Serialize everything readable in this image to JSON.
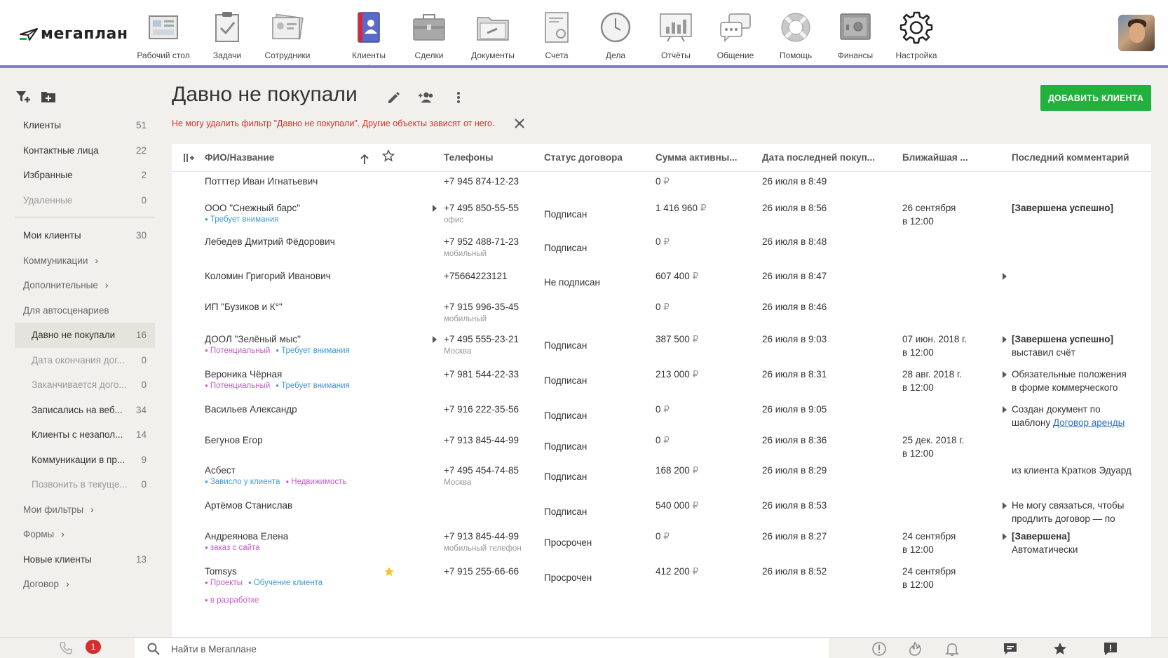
{
  "logo": {
    "text": "мегаплан"
  },
  "nav": [
    {
      "label": "Рабочий стол",
      "icon": "desktop-icon"
    },
    {
      "label": "Задачи",
      "icon": "tasks-icon"
    },
    {
      "label": "Сотрудники",
      "icon": "employees-icon"
    },
    {
      "label": "Клиенты",
      "icon": "clients-icon",
      "active": true
    },
    {
      "label": "Сделки",
      "icon": "deals-icon"
    },
    {
      "label": "Документы",
      "icon": "documents-icon"
    },
    {
      "label": "Счета",
      "icon": "invoices-icon"
    },
    {
      "label": "Дела",
      "icon": "affairs-icon"
    },
    {
      "label": "Отчёты",
      "icon": "reports-icon"
    },
    {
      "label": "Общение",
      "icon": "chat-icon"
    },
    {
      "label": "Помощь",
      "icon": "help-icon"
    },
    {
      "label": "Финансы",
      "icon": "finance-icon"
    },
    {
      "label": "Настройка",
      "icon": "settings-icon"
    }
  ],
  "sidebar": {
    "items": [
      {
        "label": "Клиенты",
        "count": "51"
      },
      {
        "label": "Контактные лица",
        "count": "22"
      },
      {
        "label": "Избранные",
        "count": "2"
      },
      {
        "label": "Удаленные",
        "count": "0"
      },
      {
        "label": "Мои клиенты",
        "count": "30"
      },
      {
        "label": "Коммуникации",
        "count": ""
      },
      {
        "label": "Дополнительные",
        "count": ""
      },
      {
        "label": "Для автосценариев",
        "count": ""
      },
      {
        "label": "Давно не покупали",
        "count": "16"
      },
      {
        "label": "Дата окончания дог...",
        "count": "0"
      },
      {
        "label": "Заканчивается дого...",
        "count": "0"
      },
      {
        "label": "Записались на веб...",
        "count": "34"
      },
      {
        "label": "Клиенты с незапол...",
        "count": "14"
      },
      {
        "label": "Коммуникации в пр...",
        "count": "9"
      },
      {
        "label": "Позвонить в текуще...",
        "count": "0"
      },
      {
        "label": "Мои фильтры",
        "count": ""
      },
      {
        "label": "Формы",
        "count": ""
      },
      {
        "label": "Новые клиенты",
        "count": "13"
      },
      {
        "label": "Договор",
        "count": ""
      }
    ]
  },
  "page": {
    "title": "Давно не покупали",
    "error": "Не могу удалить фильтр \"Давно не покупали\". Другие объекты зависят от него.",
    "add_button": "ДОБАВИТЬ КЛИЕНТА"
  },
  "table": {
    "headers": {
      "name": "ФИО/Название",
      "phones": "Телефоны",
      "status": "Статус договора",
      "sum": "Сумма активны...",
      "last_purchase": "Дата последней покуп...",
      "next": "Ближайшая ...",
      "comment": "Последний комментарий"
    },
    "rows": [
      {
        "name": "Потттер Иван Игнатьевич",
        "phone": "+7 945 874-12-23",
        "phone_sub": "",
        "status": "",
        "sum": "0",
        "date": "26 июля в 8:49",
        "next1": "",
        "next2": "",
        "comment1": "",
        "comment2": ""
      },
      {
        "name": "ООО \"Снежный барс\"",
        "phone": "+7 495 850-55-55",
        "phone_sub": "офис",
        "status": "Подписан",
        "sum": "1 416 960",
        "date": "26 июля в 8:56",
        "next1": "26 сентября",
        "next2": "в 12:00",
        "comment1": "[Завершена успешно]",
        "comment2": ""
      },
      {
        "name": "Лебедев Дмитрий Фёдорович",
        "phone": "+7 952 488-71-23",
        "phone_sub": "мобильный",
        "status": "Подписан",
        "sum": "0",
        "date": "26 июля в 8:48",
        "next1": "",
        "next2": "",
        "comment1": "",
        "comment2": ""
      },
      {
        "name": "Коломин Григорий Иванович",
        "phone": "+75664223121",
        "phone_sub": "",
        "status": "Не подписан",
        "sum": "607 400",
        "date": "26 июля в 8:47",
        "next1": "",
        "next2": "",
        "comment1": "",
        "comment2": ""
      },
      {
        "name": "ИП \"Бузиков и К°\"",
        "phone": "+7 915 996-35-45",
        "phone_sub": "мобильный",
        "status": "",
        "sum": "0",
        "date": "26 июля в 8:46",
        "next1": "",
        "next2": "",
        "comment1": "",
        "comment2": ""
      },
      {
        "name": "ДООЛ \"Зелёный мыс\"",
        "phone": "+7 495 555-23-21",
        "phone_sub": "Москва",
        "status": "Подписан",
        "sum": "387 500",
        "date": "26 июля в 9:03",
        "next1": "07 июн. 2018 г.",
        "next2": "в 12:00",
        "comment1": "[Завершена успешно]",
        "comment2": "выставил счёт"
      },
      {
        "name": "Вероника Чёрная",
        "phone": "+7 981 544-22-33",
        "phone_sub": "",
        "status": "Подписан",
        "sum": "213 000",
        "date": "26 июля в 8:31",
        "next1": "28 авг. 2018 г.",
        "next2": "в 12:00",
        "comment1": "Обязательные положения",
        "comment2": "в форме коммерческого"
      },
      {
        "name": "Васильев Александр",
        "phone": "+7 916 222-35-56",
        "phone_sub": "",
        "status": "Подписан",
        "sum": "0",
        "date": "26 июля в 9:05",
        "next1": "",
        "next2": "",
        "comment1": "Создан документ по",
        "comment2": "шаблону",
        "comment_link": "Договор аренды"
      },
      {
        "name": "Бегунов Егор",
        "phone": "+7 913 845-44-99",
        "phone_sub": "",
        "status": "Подписан",
        "sum": "0",
        "date": "26 июля в 8:36",
        "next1": "25 дек. 2018 г.",
        "next2": "в 12:00",
        "comment1": "",
        "comment2": ""
      },
      {
        "name": "Асбест",
        "phone": "+7 495 454-74-85",
        "phone_sub": "Москва",
        "status": "Подписан",
        "sum": "168 200",
        "date": "26 июля в 8:29",
        "next1": "",
        "next2": "",
        "comment1": "из клиента Кратков Эдуард",
        "comment2": ""
      },
      {
        "name": "Артёмов Станислав",
        "phone": "",
        "phone_sub": "",
        "status": "Подписан",
        "sum": "540 000",
        "date": "26 июля в 8:53",
        "next1": "",
        "next2": "",
        "comment1": "Не могу связаться, чтобы",
        "comment2": "продлить договор — по"
      },
      {
        "name": "Андреянова Елена",
        "phone": "+7 913 845-44-99",
        "phone_sub": "мобильный телефон",
        "status": "Просрочен",
        "sum": "0",
        "date": "26 июля в 8:27",
        "next1": "24 сентября",
        "next2": "в 12:00",
        "comment1": "[Завершена]",
        "comment2": "Автоматически"
      },
      {
        "name": "Tomsys",
        "phone": "+7 915 255-66-66",
        "phone_sub": "",
        "status": "Просрочен",
        "sum": "412 200",
        "date": "26 июля в 8:52",
        "next1": "24 сентября",
        "next2": "в 12:00",
        "comment1": "",
        "comment2": ""
      }
    ],
    "currency": "₽",
    "tags": {
      "needs_attention": "Требует внимания",
      "potential": "Потенциальный",
      "depends_on_client": "Зависло у клиента",
      "real_estate": "Недвижимость",
      "site_order": "заказ с сайта",
      "projects": "Проекты",
      "client_training": "Обучение клиента",
      "in_development": "в разработке"
    }
  },
  "bottom": {
    "badge": "1",
    "search_placeholder": "Найти в Мегаплане"
  },
  "colors": {
    "accent": "#7b7fc9",
    "add_button": "#21b23d",
    "error": "#e02b2b",
    "tag_blue": "#3f9ad6",
    "tag_pink": "#c25bc8"
  }
}
